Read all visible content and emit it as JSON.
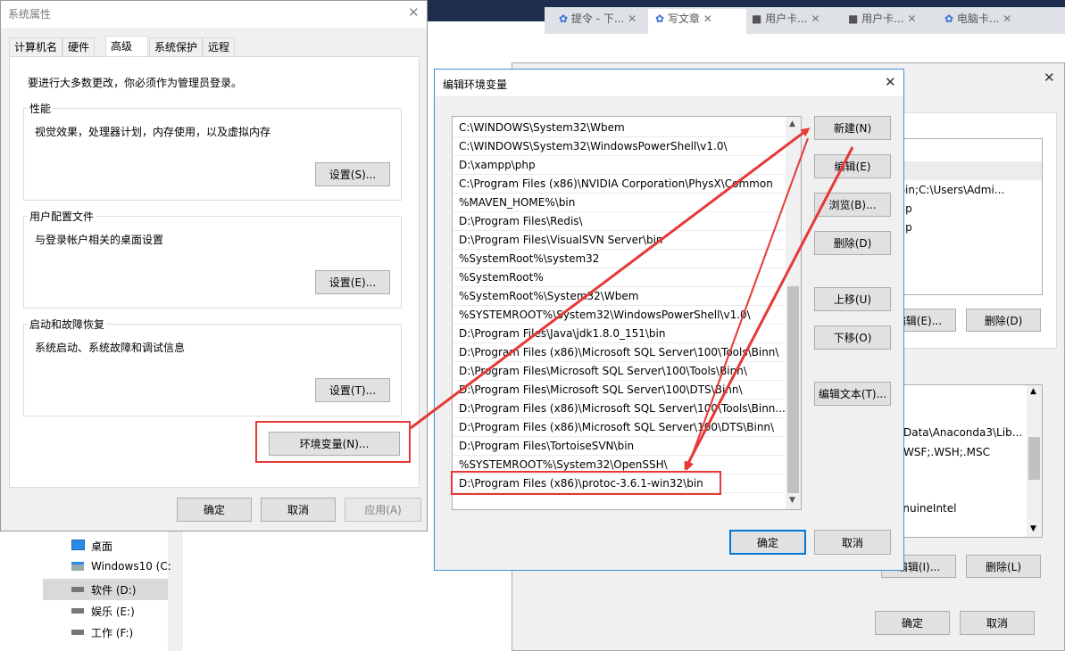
{
  "browser_tabs": [
    "提令 - 下...",
    "写文章",
    "用户卡...",
    "用户卡...",
    "电脑卡..."
  ],
  "explorer": {
    "items": [
      {
        "label": "桌面",
        "icon": "desktop-icon"
      },
      {
        "label": "Windows10 (C:",
        "icon": "windows-drive-icon"
      },
      {
        "label": "软件 (D:)",
        "icon": "drive-icon"
      },
      {
        "label": "娱乐 (E:)",
        "icon": "drive-icon"
      },
      {
        "label": "工作 (F:)",
        "icon": "drive-icon"
      }
    ]
  },
  "env_vars_window": {
    "visible_texts": [
      "e\\bin;C:\\Users\\Admi...",
      "emp",
      "emp",
      "Data\\Anaconda3\\Lib...",
      "WSF;.WSH;.MSC",
      "enuineIntel"
    ],
    "user_edit_label": "编辑(E)...",
    "user_delete_label": "删除(D)",
    "sys_edit_label": "编辑(I)...",
    "sys_delete_label": "删除(L)",
    "ok_label": "确定",
    "cancel_label": "取消"
  },
  "sys_props": {
    "title": "系统属性",
    "tabs": [
      "计算机名",
      "硬件",
      "高级",
      "系统保护",
      "远程"
    ],
    "active_tab": "高级",
    "admin_note": "要进行大多数更改，你必须作为管理员登录。",
    "perf": {
      "label": "性能",
      "desc": "视觉效果，处理器计划，内存使用，以及虚拟内存",
      "button": "设置(S)..."
    },
    "profile": {
      "label": "用户配置文件",
      "desc": "与登录帐户相关的桌面设置",
      "button": "设置(E)..."
    },
    "startup": {
      "label": "启动和故障恢复",
      "desc": "系统启动、系统故障和调试信息",
      "button": "设置(T)..."
    },
    "env_button": "环境变量(N)...",
    "ok": "确定",
    "cancel": "取消",
    "apply": "应用(A)"
  },
  "edit_env": {
    "title": "编辑环境变量",
    "paths": [
      "C:\\WINDOWS\\System32\\Wbem",
      "C:\\WINDOWS\\System32\\WindowsPowerShell\\v1.0\\",
      "D:\\xampp\\php",
      "C:\\Program Files (x86)\\NVIDIA Corporation\\PhysX\\Common",
      "%MAVEN_HOME%\\bin",
      "D:\\Program Files\\Redis\\",
      "D:\\Program Files\\VisualSVN Server\\bin",
      "%SystemRoot%\\system32",
      "%SystemRoot%",
      "%SystemRoot%\\System32\\Wbem",
      "%SYSTEMROOT%\\System32\\WindowsPowerShell\\v1.0\\",
      "D:\\Program Files\\Java\\jdk1.8.0_151\\bin",
      "D:\\Program Files (x86)\\Microsoft SQL Server\\100\\Tools\\Binn\\",
      "D:\\Program Files\\Microsoft SQL Server\\100\\Tools\\Binn\\",
      "D:\\Program Files\\Microsoft SQL Server\\100\\DTS\\Binn\\",
      "D:\\Program Files (x86)\\Microsoft SQL Server\\100\\Tools\\Binn...",
      "D:\\Program Files (x86)\\Microsoft SQL Server\\100\\DTS\\Binn\\",
      "D:\\Program Files\\TortoiseSVN\\bin",
      "%SYSTEMROOT%\\System32\\OpenSSH\\",
      "D:\\Program Files (x86)\\protoc-3.6.1-win32\\bin"
    ],
    "buttons": {
      "new": "新建(N)",
      "edit": "编辑(E)",
      "browse": "浏览(B)...",
      "delete": "删除(D)",
      "move_up": "上移(U)",
      "move_down": "下移(O)",
      "edit_text": "编辑文本(T)..."
    },
    "ok": "确定",
    "cancel": "取消"
  },
  "colors": {
    "annotation": "#e53935",
    "focus": "#0078d7",
    "taskbar": "#1f2d4d"
  }
}
